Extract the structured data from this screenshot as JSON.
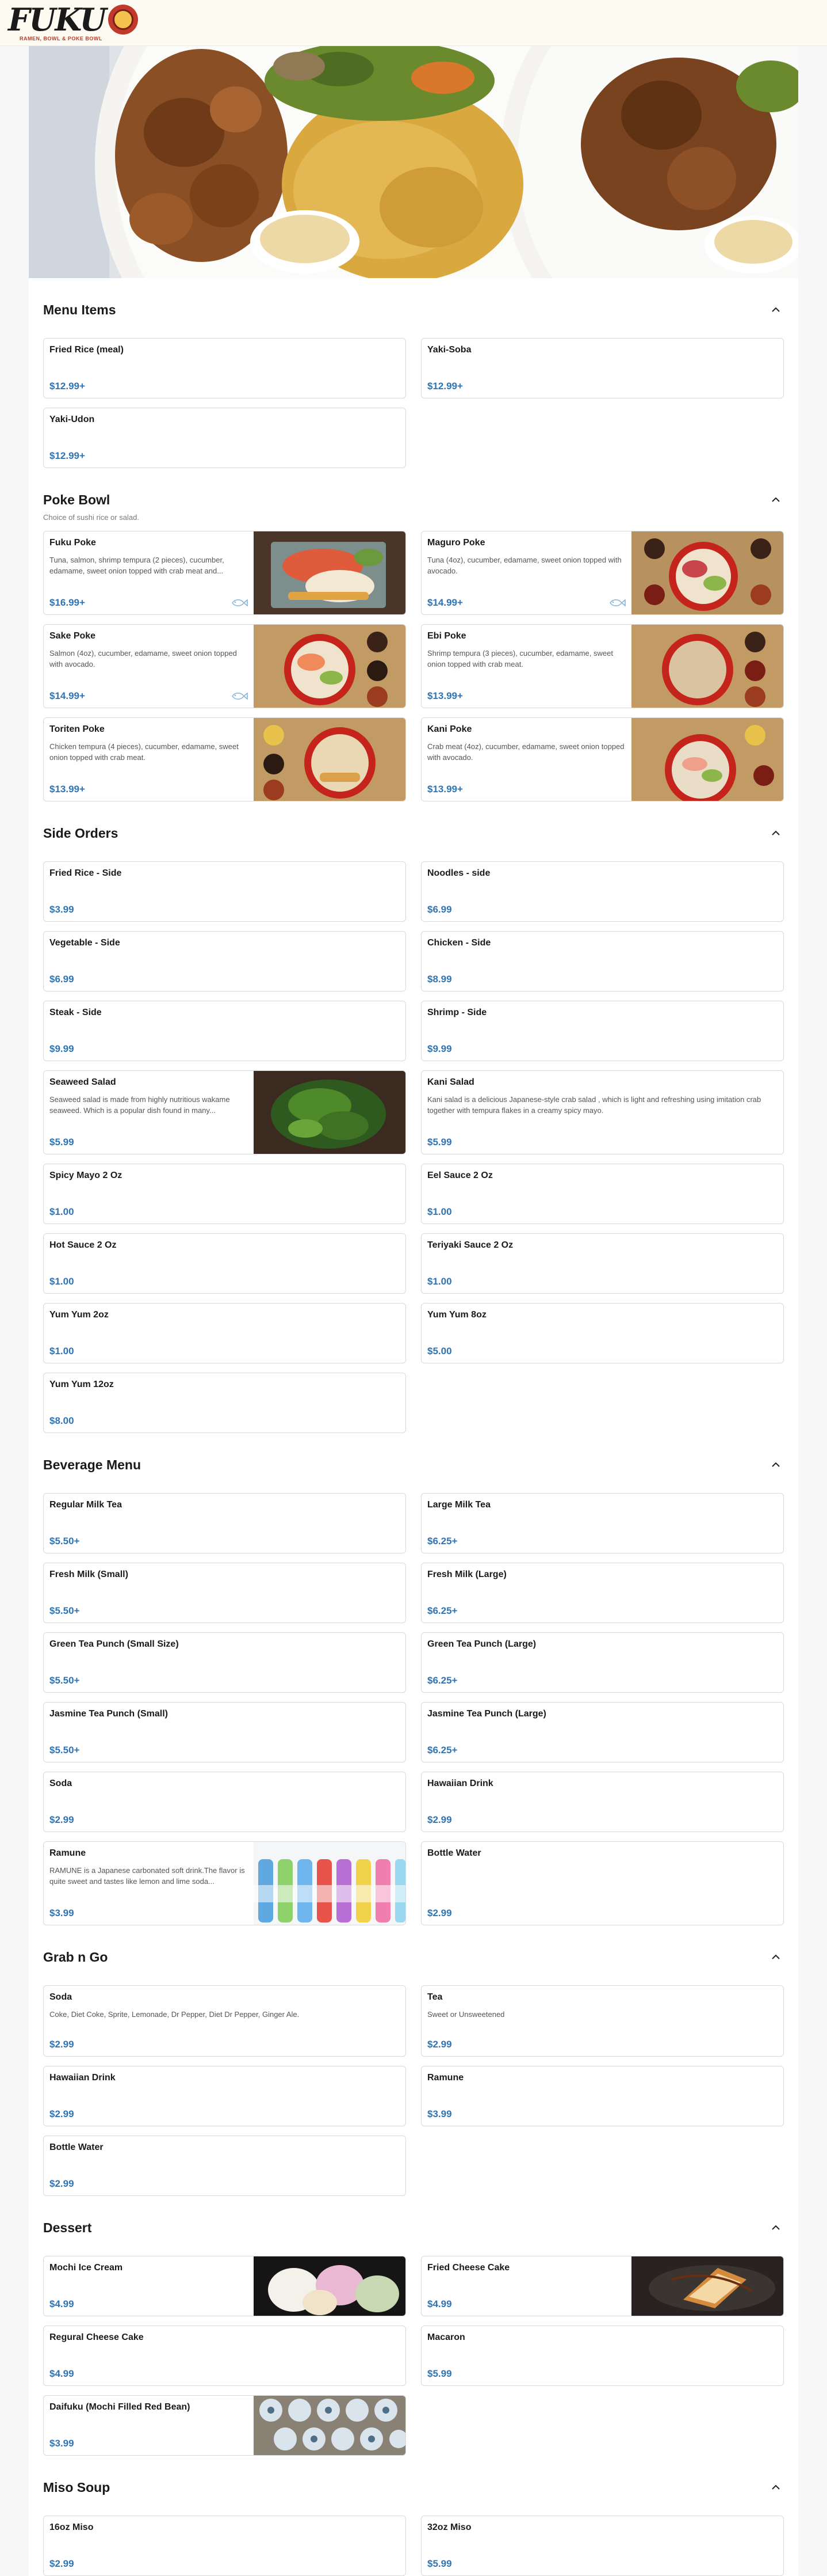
{
  "brand": {
    "logo_word": "FUKU",
    "tagline": "RAMEN, BOWL & POKE BOWL",
    "colors": {
      "accent": "#2e74b5",
      "brand_red": "#c0392b",
      "topbar_bg": "#fdfbf1"
    }
  },
  "icons": {
    "collapse": "chevron-up-icon",
    "sushi_rice": "fish-icon"
  },
  "sections": [
    {
      "title": "Menu Items",
      "subtitle": "",
      "items": [
        {
          "name": "Fried Rice (meal)",
          "price": "$12.99+"
        },
        {
          "name": "Yaki-Soba",
          "price": "$12.99+"
        },
        {
          "name": "Yaki-Udon",
          "price": "$12.99+"
        }
      ]
    },
    {
      "title": "Poke Bowl",
      "subtitle": "Choice of sushi rice or salad.",
      "items": [
        {
          "name": "Fuku Poke",
          "description": "Tuna, salmon, shrimp tempura (2 pieces), cucumber, edamame, sweet onion topped with crab meat and...",
          "price": "$16.99+",
          "image": "fuku-poke-photo"
        },
        {
          "name": "Maguro Poke",
          "description": "Tuna (4oz), cucumber, edamame, sweet onion topped with avocado.",
          "price": "$14.99+",
          "image": "maguro-poke-photo"
        },
        {
          "name": "Sake Poke",
          "description": "Salmon (4oz), cucumber, edamame, sweet onion topped with avocado.",
          "price": "$14.99+",
          "image": "sake-poke-photo"
        },
        {
          "name": "Ebi Poke",
          "description": "Shrimp tempura (3 pieces), cucumber, edamame, sweet onion topped with crab meat.",
          "price": "$13.99+",
          "image": "ebi-poke-photo"
        },
        {
          "name": "Toriten Poke",
          "description": "Chicken tempura (4 pieces), cucumber, edamame, sweet onion topped with crab meat.",
          "price": "$13.99+",
          "image": "toriten-poke-photo"
        },
        {
          "name": "Kani Poke",
          "description": "Crab meat (4oz), cucumber, edamame, sweet onion topped with avocado.",
          "price": "$13.99+",
          "image": "kani-poke-photo"
        }
      ]
    },
    {
      "title": "Side Orders",
      "subtitle": "",
      "items": [
        {
          "name": "Fried Rice - Side",
          "price": "$3.99"
        },
        {
          "name": "Noodles - side",
          "price": "$6.99"
        },
        {
          "name": "Vegetable - Side",
          "price": "$6.99"
        },
        {
          "name": "Chicken - Side",
          "price": "$8.99"
        },
        {
          "name": "Steak - Side",
          "price": "$9.99"
        },
        {
          "name": "Shrimp - Side",
          "price": "$9.99"
        },
        {
          "name": "Seaweed Salad",
          "description": "Seaweed salad is made from highly nutritious wakame seaweed. Which is a popular dish found in many...",
          "price": "$5.99",
          "image": "seaweed-salad-photo"
        },
        {
          "name": "Kani Salad",
          "description": "Kani salad is a delicious Japanese-style crab salad , which is light and refreshing using imitation crab together with tempura flakes in a creamy spicy mayo.",
          "price": "$5.99"
        },
        {
          "name": "Spicy Mayo 2 Oz",
          "price": "$1.00"
        },
        {
          "name": "Eel Sauce 2 Oz",
          "price": "$1.00"
        },
        {
          "name": "Hot Sauce 2 Oz",
          "price": "$1.00"
        },
        {
          "name": "Teriyaki Sauce 2 Oz",
          "price": "$1.00"
        },
        {
          "name": "Yum Yum 2oz",
          "price": "$1.00"
        },
        {
          "name": "Yum Yum 8oz",
          "price": "$5.00"
        },
        {
          "name": "Yum Yum 12oz",
          "price": "$8.00"
        }
      ]
    },
    {
      "title": "Beverage Menu",
      "subtitle": "",
      "items": [
        {
          "name": "Regular Milk Tea",
          "price": "$5.50+"
        },
        {
          "name": "Large Milk Tea",
          "price": "$6.25+"
        },
        {
          "name": "Fresh Milk (Small)",
          "price": "$5.50+"
        },
        {
          "name": "Fresh Milk (Large)",
          "price": "$6.25+"
        },
        {
          "name": "Green Tea Punch (Small Size)",
          "price": "$5.50+"
        },
        {
          "name": "Green Tea Punch (Large)",
          "price": "$6.25+"
        },
        {
          "name": "Jasmine Tea Punch (Small)",
          "price": "$5.50+"
        },
        {
          "name": "Jasmine Tea Punch (Large)",
          "price": "$6.25+"
        },
        {
          "name": "Soda",
          "price": "$2.99"
        },
        {
          "name": "Hawaiian Drink",
          "price": "$2.99"
        },
        {
          "name": "Ramune",
          "description": "RAMUNE is a Japanese carbonated soft drink.The flavor is quite sweet and tastes like lemon and lime soda...",
          "price": "$3.99",
          "image": "ramune-bottles-photo"
        },
        {
          "name": "Bottle Water",
          "price": "$2.99"
        }
      ]
    },
    {
      "title": "Grab n Go",
      "subtitle": "",
      "items": [
        {
          "name": "Soda",
          "description": "Coke, Diet Coke, Sprite, Lemonade, Dr Pepper, Diet Dr Pepper, Ginger Ale.",
          "price": "$2.99"
        },
        {
          "name": "Tea",
          "description": "Sweet or Unsweetened",
          "price": "$2.99"
        },
        {
          "name": "Hawaiian Drink",
          "price": "$2.99"
        },
        {
          "name": "Ramune",
          "price": "$3.99"
        },
        {
          "name": "Bottle Water",
          "price": "$2.99"
        }
      ]
    },
    {
      "title": "Dessert",
      "subtitle": "",
      "items": [
        {
          "name": "Mochi Ice Cream",
          "price": "$4.99",
          "image": "mochi-photo"
        },
        {
          "name": "Fried Cheese Cake",
          "price": "$4.99",
          "image": "cheesecake-photo"
        },
        {
          "name": "Regural Cheese Cake",
          "price": "$4.99"
        },
        {
          "name": "Macaron",
          "price": "$5.99"
        },
        {
          "name": "Daifuku (Mochi Filled Red Bean)",
          "price": "$3.99",
          "image": "daifuku-photo"
        }
      ]
    },
    {
      "title": "Miso Soup",
      "subtitle": "",
      "items": [
        {
          "name": "16oz Miso",
          "price": "$2.99"
        },
        {
          "name": "32oz Miso",
          "price": "$5.99"
        }
      ]
    }
  ]
}
